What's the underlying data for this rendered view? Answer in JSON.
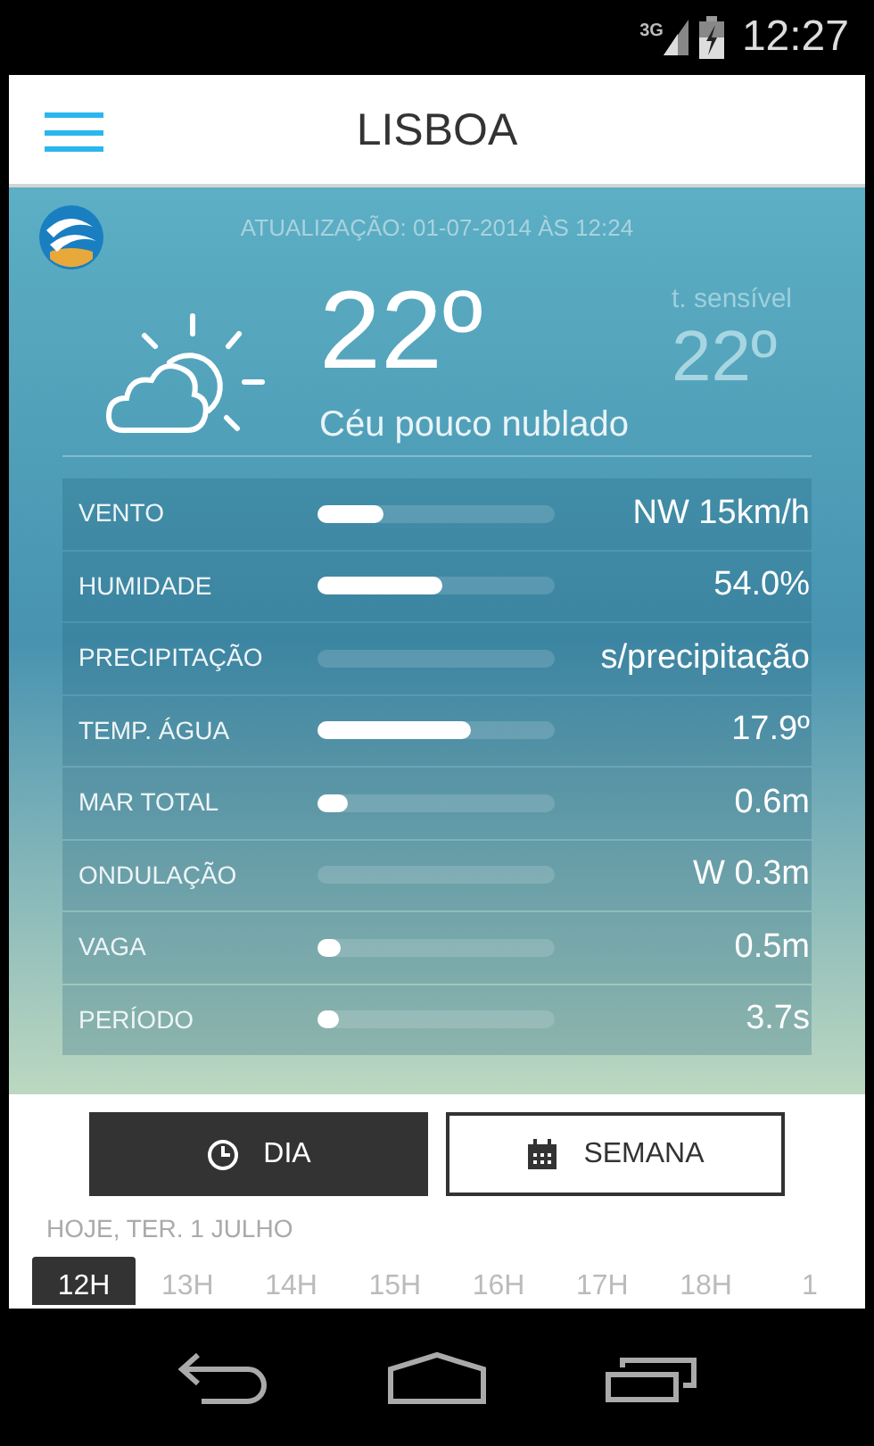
{
  "status_bar": {
    "network": "3G",
    "time": "12:27"
  },
  "header": {
    "title": "LISBOA"
  },
  "weather": {
    "updated": "ATUALIZAÇÃO: 01-07-2014 ÀS 12:24",
    "temperature": "22º",
    "feels_label": "t. sensível",
    "feels_value": "22º",
    "condition": "Céu pouco nublado"
  },
  "metrics": [
    {
      "label": "VENTO",
      "level": 0.28,
      "value": "NW 15km/h"
    },
    {
      "label": "HUMIDADE",
      "level": 0.53,
      "value": "54.0%"
    },
    {
      "label": "PRECIPITAÇÃO",
      "value": "s/precipitação"
    },
    {
      "label": "TEMP. ÁGUA",
      "level": 0.65,
      "value": "17.9º"
    },
    {
      "label": "MAR TOTAL",
      "level": 0.13,
      "value": "0.6m"
    },
    {
      "label": "ONDULAÇÃO",
      "value": "W 0.3m"
    },
    {
      "label": "VAGA",
      "level": 0.1,
      "value": "0.5m"
    },
    {
      "label": "PERÍODO",
      "level": 0.09,
      "value": "3.7s"
    }
  ],
  "view_tabs": [
    {
      "label": "DIA",
      "kind": "clock",
      "selected": true
    },
    {
      "label": "SEMANA",
      "kind": "calendar",
      "selected": false
    }
  ],
  "day_label": "HOJE, TER. 1 JULHO",
  "hours": [
    {
      "label": "12H",
      "selected": true
    },
    {
      "label": "13H",
      "selected": false
    },
    {
      "label": "14H",
      "selected": false
    },
    {
      "label": "15H",
      "selected": false
    },
    {
      "label": "16H",
      "selected": false
    },
    {
      "label": "17H",
      "selected": false
    },
    {
      "label": "18H",
      "selected": false
    },
    {
      "label": "1",
      "selected": false
    }
  ]
}
